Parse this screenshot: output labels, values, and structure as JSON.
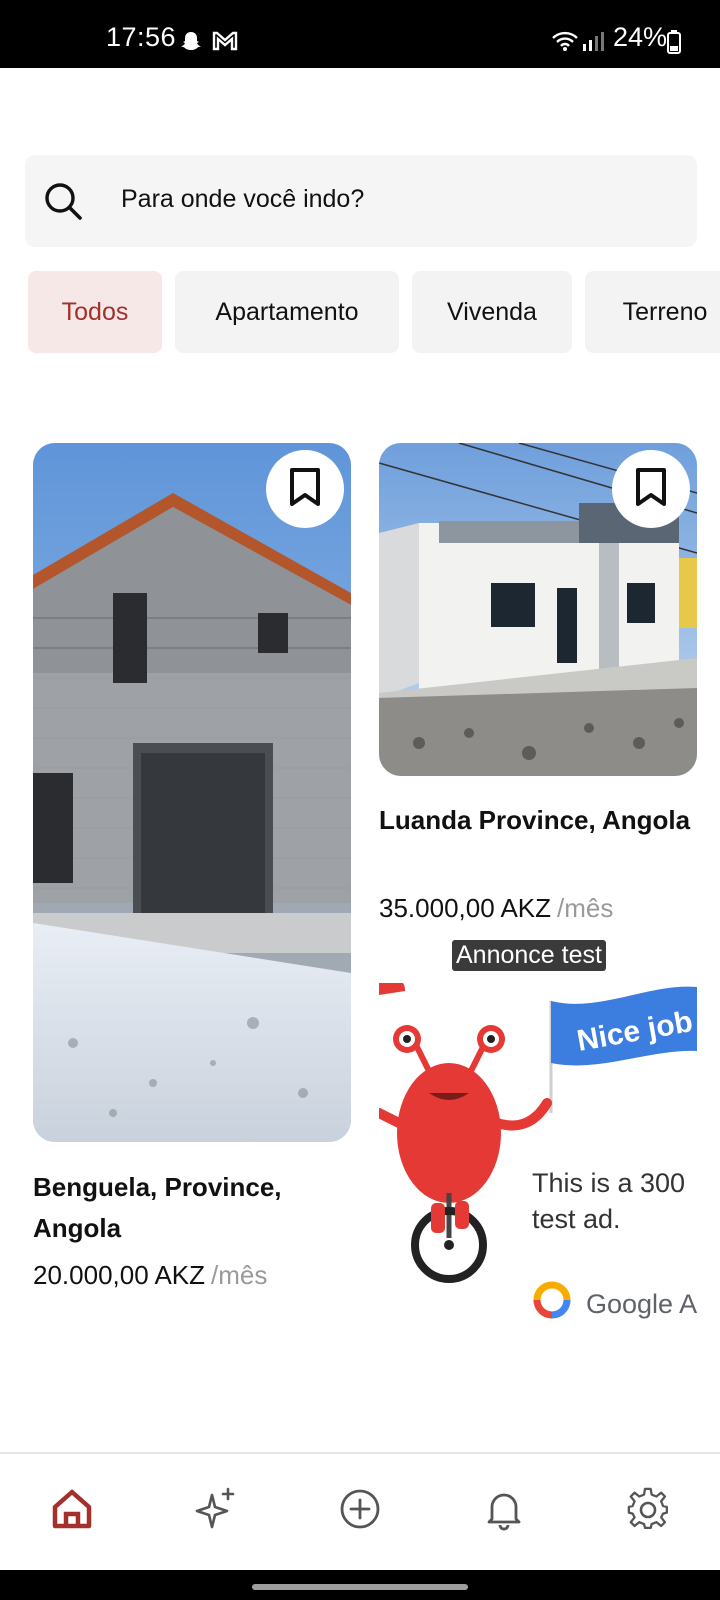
{
  "status_bar": {
    "time": "17:56",
    "battery": "24%",
    "icons": [
      "snapchat-icon",
      "gmail-icon",
      "wifi-icon",
      "signal-icon",
      "battery-icon"
    ]
  },
  "search": {
    "placeholder": "Para onde você indo?"
  },
  "filters": [
    {
      "label": "Todos",
      "active": true
    },
    {
      "label": "Apartamento",
      "active": false
    },
    {
      "label": "Vivenda",
      "active": false
    },
    {
      "label": "Terreno",
      "active": false
    }
  ],
  "listings": [
    {
      "location": "Benguela, Province, Angola",
      "price": "20.000,00 AKZ",
      "unit": "/mês"
    },
    {
      "location": "Luanda Province, Angola",
      "price": "35.000,00 AKZ",
      "unit": "/mês"
    }
  ],
  "ad": {
    "label": "Annonce test",
    "flag_text": "Nice job",
    "text_line1": "This is a 300",
    "text_line2": "test ad.",
    "brand": "Google A"
  },
  "bottom_nav": [
    "home-icon",
    "sparkles-icon",
    "add-circle-icon",
    "bell-icon",
    "gear-icon"
  ],
  "colors": {
    "accent": "#a3302c",
    "chip_active_bg": "#f7e8e8",
    "chip_bg": "#f3f3f3"
  }
}
